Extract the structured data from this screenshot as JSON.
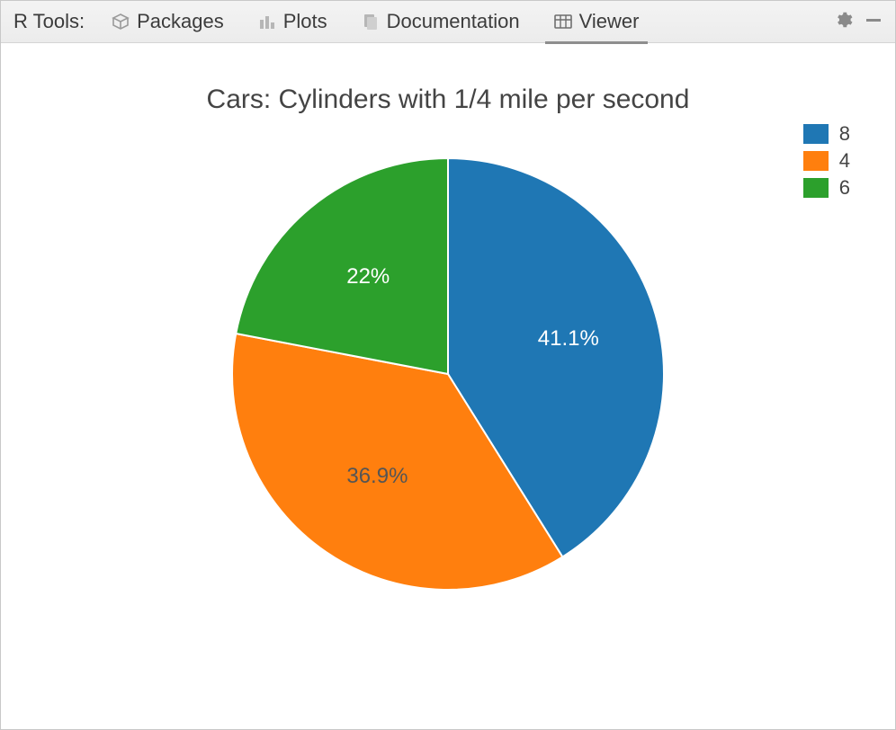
{
  "toolbar": {
    "title": "R Tools:",
    "tabs": [
      {
        "id": "packages",
        "label": "Packages",
        "icon": "package-icon",
        "active": false
      },
      {
        "id": "plots",
        "label": "Plots",
        "icon": "plots-icon",
        "active": false
      },
      {
        "id": "documentation",
        "label": "Documentation",
        "icon": "documents-icon",
        "active": false
      },
      {
        "id": "viewer",
        "label": "Viewer",
        "icon": "viewer-icon",
        "active": true
      }
    ],
    "settings_icon": "gear-icon",
    "minimize_icon": "minimize-icon"
  },
  "chart_data": {
    "type": "pie",
    "title": "Cars: Cylinders with 1/4 mile per second",
    "series": [
      {
        "name": "8",
        "value": 41.1,
        "label": "41.1%",
        "color": "#1f77b4",
        "label_color": "light"
      },
      {
        "name": "4",
        "value": 36.9,
        "label": "36.9%",
        "color": "#ff7f0e",
        "label_color": "dark"
      },
      {
        "name": "6",
        "value": 22.0,
        "label": "22%",
        "color": "#2ca02c",
        "label_color": "light"
      }
    ],
    "legend_position": "top-right"
  }
}
